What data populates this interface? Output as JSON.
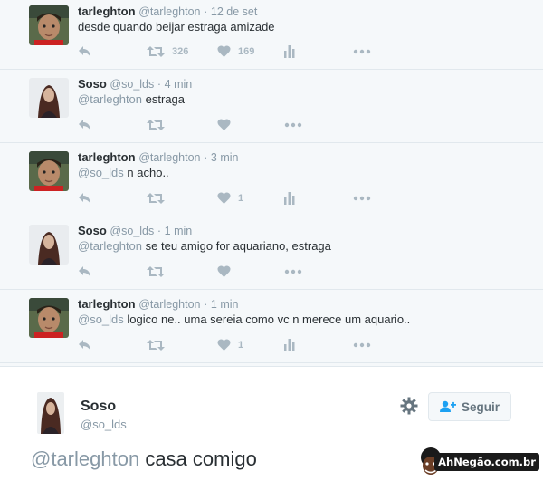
{
  "tweets": [
    {
      "name": "tarleghton",
      "handle": "@tarleghton",
      "dot": "·",
      "time": "12 de set",
      "mention": "",
      "text": "desde quando beijar estraga amizade",
      "rt_count": "326",
      "like_count": "169",
      "avatar": "boy",
      "show_stats": true
    },
    {
      "name": "Soso",
      "handle": "@so_lds",
      "dot": "·",
      "time": "4 min",
      "mention": "@tarleghton",
      "text": "estraga",
      "rt_count": "",
      "like_count": "",
      "avatar": "girl",
      "show_stats": false
    },
    {
      "name": "tarleghton",
      "handle": "@tarleghton",
      "dot": "·",
      "time": "3 min",
      "mention": "@so_lds",
      "text": "n acho..",
      "rt_count": "",
      "like_count": "1",
      "avatar": "boy",
      "show_stats": true
    },
    {
      "name": "Soso",
      "handle": "@so_lds",
      "dot": "·",
      "time": "1 min",
      "mention": "@tarleghton",
      "text": "se teu amigo for aquariano, estraga",
      "rt_count": "",
      "like_count": "",
      "avatar": "girl",
      "show_stats": false
    },
    {
      "name": "tarleghton",
      "handle": "@tarleghton",
      "dot": "·",
      "time": "1 min",
      "mention": "@so_lds",
      "text": "logico ne.. uma sereia como vc n merece um aquario..",
      "rt_count": "",
      "like_count": "1",
      "avatar": "boy",
      "show_stats": true
    }
  ],
  "focus": {
    "name": "Soso",
    "handle": "@so_lds",
    "follow_label": "Seguir",
    "mention": "@tarleghton",
    "text": "casa comigo"
  },
  "watermark": {
    "text": "AhNegão.com.br"
  },
  "icons": {
    "reply": "reply-icon",
    "retweet": "retweet-icon",
    "like": "heart-icon",
    "stats": "stats-icon",
    "more": "more-icon",
    "gear": "gear-icon",
    "follow": "add-user-icon"
  },
  "colors": {
    "muted": "#8899a6",
    "icon": "#aab8c2",
    "text": "#292f33",
    "bg": "#f5f8fa"
  }
}
